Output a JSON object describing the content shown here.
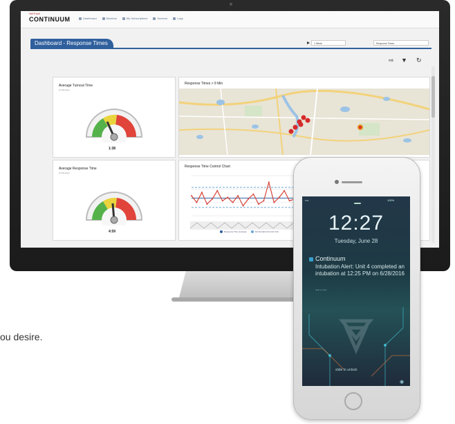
{
  "app": {
    "logo": "CONTINUUM",
    "logo_sup": "NetTrack",
    "nav": [
      "Dashboard",
      "Monitors",
      "My Subscriptions",
      "Screens",
      "Logs"
    ]
  },
  "dashboard": {
    "title": "Dashboard - Response Times",
    "time_range": "1 Week",
    "metric_select": "Response Times"
  },
  "panels": {
    "turnout": {
      "title": "Average Turnout Time",
      "subtitle": "(in Minutes)",
      "value": "1:38",
      "gauge_level": 0.42
    },
    "response": {
      "title": "Average Response Time",
      "subtitle": "(in Minutes)",
      "value": "4:59",
      "gauge_level": 0.55
    },
    "map": {
      "title": "Response Times > 9 Min"
    },
    "control_chart": {
      "title": "Response Time Control Chart",
      "legend": [
        "Response Time average",
        "Std Deviation/Control limit"
      ]
    }
  },
  "partial_text": "ou desire.",
  "phone": {
    "carrier": "•••• ",
    "battery": "100%",
    "time": "12:27",
    "date": "Tuesday, June 28",
    "notification": {
      "app": "Continuum",
      "body": "Intubation Alert: Unit 4 completed an intubation at 12:25 PM on 6/28/2016",
      "subtitle": "slide to view"
    },
    "unlock": "slide to unlock"
  },
  "colors": {
    "brand_blue": "#2f5f9d",
    "gauge_green": "#55b24b",
    "gauge_yellow": "#e9d43d",
    "gauge_red": "#e0443a"
  },
  "chart_data": {
    "type": "line",
    "title": "Response Time Control Chart",
    "series": [
      {
        "name": "Response Time average",
        "values": [
          5.6,
          5.2,
          5.8,
          5.1,
          5.4,
          5.9,
          5.3,
          5.5,
          5.2,
          5.6,
          5.0,
          5.4,
          5.7,
          5.1,
          5.3,
          6.4,
          5.2,
          5.5,
          5.9,
          5.3,
          5.4,
          5.6,
          5.2
        ]
      }
    ],
    "control_limits": [
      4.9,
      6.1
    ],
    "grid": true
  }
}
